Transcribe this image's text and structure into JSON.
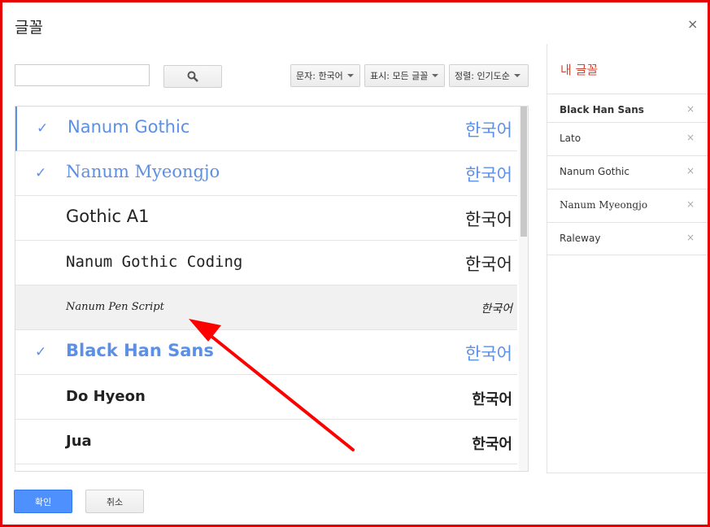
{
  "dialog": {
    "title": "글꼴",
    "close_glyph": "×"
  },
  "toolbar": {
    "search_placeholder": "",
    "search_icon": "search-icon",
    "filter_script": "문자: 한국어",
    "filter_show": "표시: 모든 글꼴",
    "filter_sort": "정렬: 인기도순"
  },
  "fonts": [
    {
      "name": "Nanum Gothic",
      "sample": "한국어",
      "selected": true
    },
    {
      "name": "Nanum Myeongjo",
      "sample": "한국어",
      "selected": true
    },
    {
      "name": "Gothic A1",
      "sample": "한국어",
      "selected": false
    },
    {
      "name": "Nanum Gothic Coding",
      "sample": "한국어",
      "selected": false
    },
    {
      "name": "Nanum Pen Script",
      "sample": "한국어",
      "selected": false
    },
    {
      "name": "Black Han Sans",
      "sample": "한국어",
      "selected": true
    },
    {
      "name": "Do Hyeon",
      "sample": "한국어",
      "selected": false
    },
    {
      "name": "Jua",
      "sample": "한국어",
      "selected": false
    }
  ],
  "check_glyph": "✓",
  "my_fonts": {
    "title": "내 글꼴",
    "remove_glyph": "×",
    "items": [
      {
        "name": "Black Han Sans"
      },
      {
        "name": "Lato"
      },
      {
        "name": "Nanum Gothic"
      },
      {
        "name": "Nanum Myeongjo"
      },
      {
        "name": "Raleway"
      }
    ]
  },
  "footer": {
    "ok_label": "확인",
    "cancel_label": "취소"
  },
  "colors": {
    "accent": "#5c8fe6",
    "annotation": "#ff0000",
    "my_fonts_title": "#d04836"
  }
}
